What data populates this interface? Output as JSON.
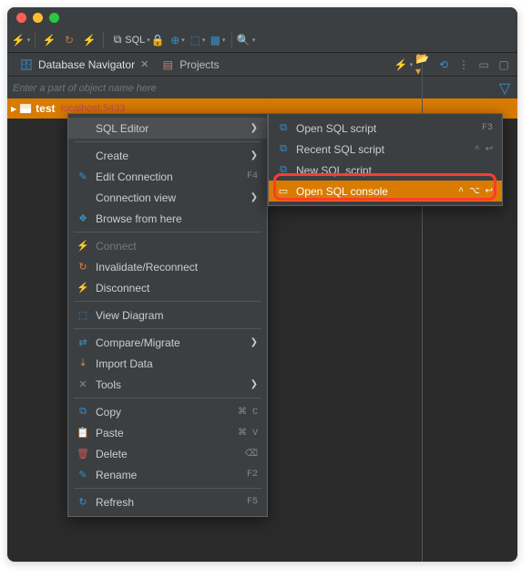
{
  "window": {
    "os_buttons": [
      "close",
      "minimize",
      "zoom"
    ]
  },
  "toolbar": {
    "sql_label": "SQL"
  },
  "navigator": {
    "tab_db": "Database Navigator",
    "tab_projects": "Projects"
  },
  "search": {
    "placeholder": "Enter a part of object name here"
  },
  "tree": {
    "selected_name": "test",
    "selected_host": "localhost:5433"
  },
  "context_menu": {
    "items": [
      {
        "icon": "",
        "label": "SQL Editor",
        "submenu": true,
        "hover": true
      },
      {
        "sep": true
      },
      {
        "icon": "",
        "label": "Create",
        "submenu": true
      },
      {
        "icon": "✎",
        "color": "#3b8ec9",
        "label": "Edit Connection",
        "shortcut": "F4"
      },
      {
        "icon": "",
        "label": "Connection view",
        "submenu": true
      },
      {
        "icon": "❖",
        "color": "#3b8ec9",
        "label": "Browse from here"
      },
      {
        "sep": true
      },
      {
        "icon": "⚡",
        "label": "Connect",
        "dim": true
      },
      {
        "icon": "↻",
        "color": "#e07d3c",
        "label": "Invalidate/Reconnect"
      },
      {
        "icon": "⚡",
        "color": "#cc5555",
        "label": "Disconnect"
      },
      {
        "sep": true
      },
      {
        "icon": "⬚",
        "color": "#3b8ec9",
        "label": "View Diagram"
      },
      {
        "sep": true
      },
      {
        "icon": "⇄",
        "color": "#3b8ec9",
        "label": "Compare/Migrate",
        "submenu": true
      },
      {
        "icon": "⤓",
        "color": "#e0a030",
        "label": "Import Data"
      },
      {
        "icon": "✕",
        "color": "#888",
        "label": "Tools",
        "submenu": true
      },
      {
        "sep": true
      },
      {
        "icon": "⧉",
        "color": "#3b8ec9",
        "label": "Copy",
        "shortcut": "⌘ C"
      },
      {
        "icon": "📋",
        "color": "#888",
        "label": "Paste",
        "shortcut": "⌘ V"
      },
      {
        "icon": "🗑",
        "color": "#cc5555",
        "label": "Delete",
        "shortcut": "⌫"
      },
      {
        "icon": "✎",
        "color": "#3b8ec9",
        "label": "Rename",
        "shortcut": "F2"
      },
      {
        "sep": true
      },
      {
        "icon": "↻",
        "color": "#3b8ec9",
        "label": "Refresh",
        "shortcut": "F5"
      }
    ]
  },
  "submenu": {
    "items": [
      {
        "icon": "⧉",
        "label": "Open SQL script",
        "shortcut": "F3"
      },
      {
        "icon": "⧉",
        "label": "Recent SQL script",
        "shortcut": "^ ↩"
      },
      {
        "icon": "⧉",
        "label": "New SQL script"
      },
      {
        "icon": "▭",
        "label": "Open SQL console",
        "shortcut": "^ ⌥ ↩",
        "selected": true
      }
    ]
  }
}
